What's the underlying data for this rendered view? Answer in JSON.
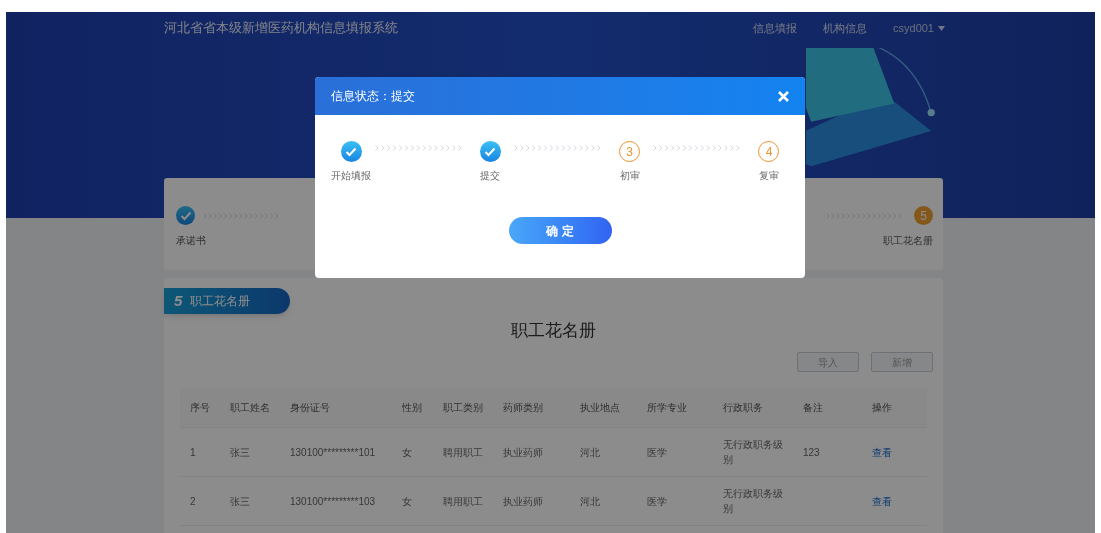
{
  "header": {
    "title": "河北省省本级新增医药机构信息填报系统",
    "nav": [
      "信息填报",
      "机构信息"
    ],
    "user": "csyd001"
  },
  "progress": {
    "steps": [
      {
        "label": "承诺书",
        "done": true
      },
      {
        "number": "5",
        "label": "职工花名册",
        "done": false
      }
    ]
  },
  "section_tab": {
    "number": "5",
    "label": "职工花名册"
  },
  "roster": {
    "title": "职工花名册",
    "buttons": [
      "导入",
      "新增"
    ],
    "columns": [
      "序号",
      "职工姓名",
      "身份证号",
      "性别",
      "职工类别",
      "药师类别",
      "执业地点",
      "所学专业",
      "行政职务",
      "备注",
      "操作"
    ],
    "rows": [
      {
        "cells": [
          "1",
          "张三",
          "130100*********101",
          "女",
          "聘用职工",
          "执业药师",
          "河北",
          "医学",
          "无行政职务级别",
          "123"
        ],
        "action": "查看"
      },
      {
        "cells": [
          "2",
          "张三",
          "130100*********103",
          "女",
          "聘用职工",
          "执业药师",
          "河北",
          "医学",
          "无行政职务级别",
          ""
        ],
        "action": "查看"
      }
    ]
  },
  "modal": {
    "title": "信息状态：提交",
    "steps": [
      {
        "label": "开始填报",
        "done": true
      },
      {
        "label": "提交",
        "done": true
      },
      {
        "number": "3",
        "label": "初审",
        "done": false
      },
      {
        "number": "4",
        "label": "复审",
        "done": false
      }
    ],
    "confirm": "确 定"
  }
}
